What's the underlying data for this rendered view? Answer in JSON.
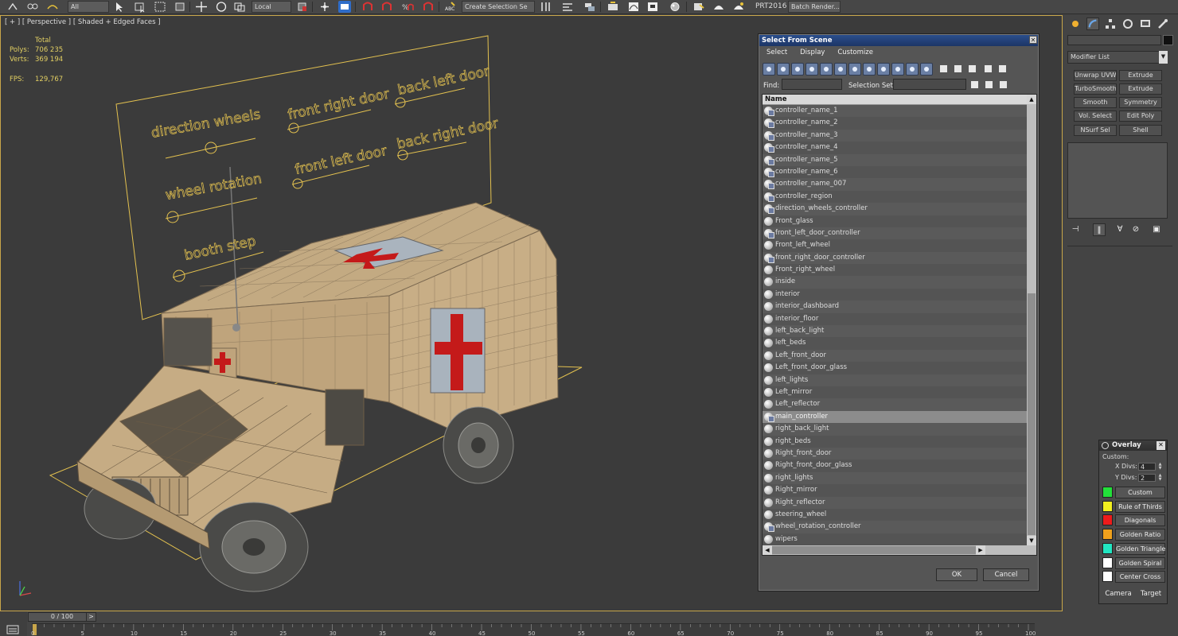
{
  "toolbar": {
    "coord_system": "Local",
    "filter": "All",
    "selection_set": "Create Selection Se",
    "workspace": "PRT2016",
    "batch_render": "Batch Render..."
  },
  "viewport": {
    "label": "[ + ] [ Perspective ] [ Shaded + Edged Faces ]",
    "stats": {
      "total_label": "Total",
      "polys_label": "Polys:",
      "polys_value": "706 235",
      "verts_label": "Verts:",
      "verts_value": "369 194",
      "fps_label": "FPS:",
      "fps_value": "129,767"
    },
    "board_labels": {
      "direction_wheels": "direction wheels",
      "front_right_door": "front right door",
      "back_left_door": "back left door",
      "wheel_rotation": "wheel rotation",
      "front_left_door": "front left door",
      "back_right_door": "back right door",
      "booth_step": "booth step"
    }
  },
  "dialog": {
    "title": "Select From Scene",
    "menu": [
      "Select",
      "Display",
      "Customize"
    ],
    "find_label": "Find:",
    "selection_set_label": "Selection Set:",
    "column_name": "Name",
    "rows": [
      {
        "name": "controller_name_1",
        "kind": "controller"
      },
      {
        "name": "controller_name_2",
        "kind": "controller"
      },
      {
        "name": "controller_name_3",
        "kind": "controller"
      },
      {
        "name": "controller_name_4",
        "kind": "controller"
      },
      {
        "name": "controller_name_5",
        "kind": "controller"
      },
      {
        "name": "controller_name_6",
        "kind": "controller"
      },
      {
        "name": "controller_name_007",
        "kind": "controller"
      },
      {
        "name": "controller_region",
        "kind": "controller"
      },
      {
        "name": "direction_wheels_controller",
        "kind": "controller"
      },
      {
        "name": "Front_glass",
        "kind": "geometry"
      },
      {
        "name": "front_left_door_controller",
        "kind": "controller"
      },
      {
        "name": "Front_left_wheel",
        "kind": "geometry"
      },
      {
        "name": "front_right_door_controller",
        "kind": "controller"
      },
      {
        "name": "Front_right_wheel",
        "kind": "geometry"
      },
      {
        "name": "inside",
        "kind": "geometry"
      },
      {
        "name": "interior",
        "kind": "geometry"
      },
      {
        "name": "interior_dashboard",
        "kind": "geometry"
      },
      {
        "name": "interior_floor",
        "kind": "geometry"
      },
      {
        "name": "left_back_light",
        "kind": "geometry"
      },
      {
        "name": "left_beds",
        "kind": "geometry"
      },
      {
        "name": "Left_front_door",
        "kind": "geometry"
      },
      {
        "name": "Left_front_door_glass",
        "kind": "geometry"
      },
      {
        "name": "left_lights",
        "kind": "geometry"
      },
      {
        "name": "Left_mirror",
        "kind": "geometry"
      },
      {
        "name": "Left_reflector",
        "kind": "geometry"
      },
      {
        "name": "main_controller",
        "kind": "controller",
        "selected": true
      },
      {
        "name": "right_back_light",
        "kind": "geometry"
      },
      {
        "name": "right_beds",
        "kind": "geometry"
      },
      {
        "name": "Right_front_door",
        "kind": "geometry"
      },
      {
        "name": "Right_front_door_glass",
        "kind": "geometry"
      },
      {
        "name": "right_lights",
        "kind": "geometry"
      },
      {
        "name": "Right_mirror",
        "kind": "geometry"
      },
      {
        "name": "Right_reflector",
        "kind": "geometry"
      },
      {
        "name": "steering_wheel",
        "kind": "geometry"
      },
      {
        "name": "wheel_rotation_controller",
        "kind": "controller"
      },
      {
        "name": "wipers",
        "kind": "geometry"
      }
    ],
    "ok_label": "OK",
    "cancel_label": "Cancel"
  },
  "command_panel": {
    "modifier_list": "Modifier List",
    "modifiers": [
      "Unwrap UVW",
      "Extrude",
      "TurboSmooth",
      "Extrude",
      "Smooth",
      "Symmetry",
      "Vol. Select",
      "Edit Poly",
      "NSurf Sel",
      "Shell"
    ]
  },
  "overlay": {
    "title": "Overlay",
    "custom_label": "Custom:",
    "xdivs_label": "X Divs:",
    "xdivs_value": "4",
    "ydivs_label": "Y Divs:",
    "ydivs_value": "2",
    "options": [
      {
        "label": "Custom",
        "color": "#22e03a"
      },
      {
        "label": "Rule of Thirds",
        "color": "#f2ef1f"
      },
      {
        "label": "Diagonals",
        "color": "#ee1b1b"
      },
      {
        "label": "Golden Ratio",
        "color": "#f0a11c"
      },
      {
        "label": "Golden Triangle",
        "color": "#22e6c2"
      },
      {
        "label": "Golden Spiral",
        "color": "#ffffff"
      },
      {
        "label": "Center Cross",
        "color": "#ffffff"
      }
    ],
    "camera_label": "Camera",
    "target_label": "Target"
  },
  "timeline": {
    "frame_display": "0 / 100",
    "tick_labels": [
      "0",
      "5",
      "10",
      "15",
      "20",
      "25",
      "30",
      "35",
      "40",
      "45",
      "50",
      "55",
      "60",
      "65",
      "70",
      "75",
      "80",
      "85",
      "90",
      "95",
      "100"
    ]
  },
  "colors": {
    "viewport_border": "#c8a64a",
    "stats_text": "#e2cf62",
    "selected_row": "#8c8c8c",
    "dialog_title": "#1c3566"
  }
}
